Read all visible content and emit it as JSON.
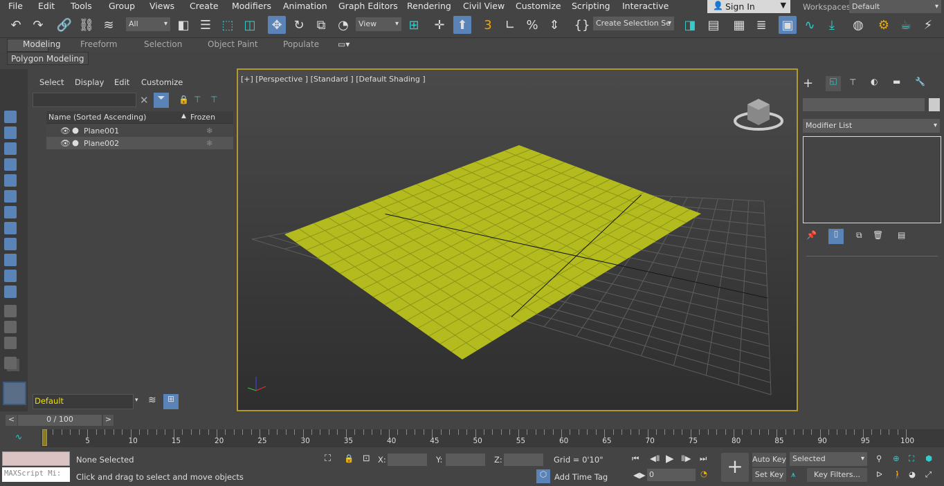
{
  "menu": [
    "File",
    "Edit",
    "Tools",
    "Group",
    "Views",
    "Create",
    "Modifiers",
    "Animation",
    "Graph Editors",
    "Rendering",
    "Civil View",
    "Customize",
    "Scripting",
    "Interactive"
  ],
  "signin": "Sign In",
  "workspaces_label": "Workspaces:",
  "workspace": "Default",
  "toolbar": {
    "filter": "All",
    "coord": "View",
    "selection_set": "Create Selection Se"
  },
  "ribbon": {
    "tabs": [
      "Modeling",
      "Freeform",
      "Selection",
      "Object Paint",
      "Populate"
    ],
    "active": "Modeling",
    "panel": "Polygon Modeling"
  },
  "scene": {
    "menu": [
      "Select",
      "Display",
      "Edit",
      "Customize"
    ],
    "search_placeholder": "",
    "col_name": "Name (Sorted Ascending)",
    "col_frozen": "Frozen",
    "rows": [
      {
        "name": "Plane001"
      },
      {
        "name": "Plane002"
      }
    ],
    "layer": "Default"
  },
  "viewport": {
    "label": "[+] [Perspective ] [Standard ] [Default Shading ]",
    "plane_color": "#b3bb1e",
    "grid_divisions": 16
  },
  "cmd": {
    "name_value": "",
    "modifier_list": "Modifier List"
  },
  "time": {
    "slider": "0 / 100",
    "ticks": [
      "0",
      "5",
      "10",
      "15",
      "20",
      "25",
      "30",
      "35",
      "40",
      "45",
      "50",
      "55",
      "60",
      "65",
      "70",
      "75",
      "80",
      "85",
      "90",
      "95",
      "100"
    ]
  },
  "status": {
    "maxscript": "MAXScript Mi:",
    "selection": "None Selected",
    "prompt": "Click and drag to select and move objects",
    "x_label": "X:",
    "y_label": "Y:",
    "z_label": "Z:",
    "grid": "Grid = 0'10\"",
    "add_time_tag": "Add Time Tag",
    "auto_key": "Auto Key",
    "set_key": "Set Key",
    "key_mode": "Selected",
    "key_filters": "Key Filters...",
    "frame": "0"
  }
}
